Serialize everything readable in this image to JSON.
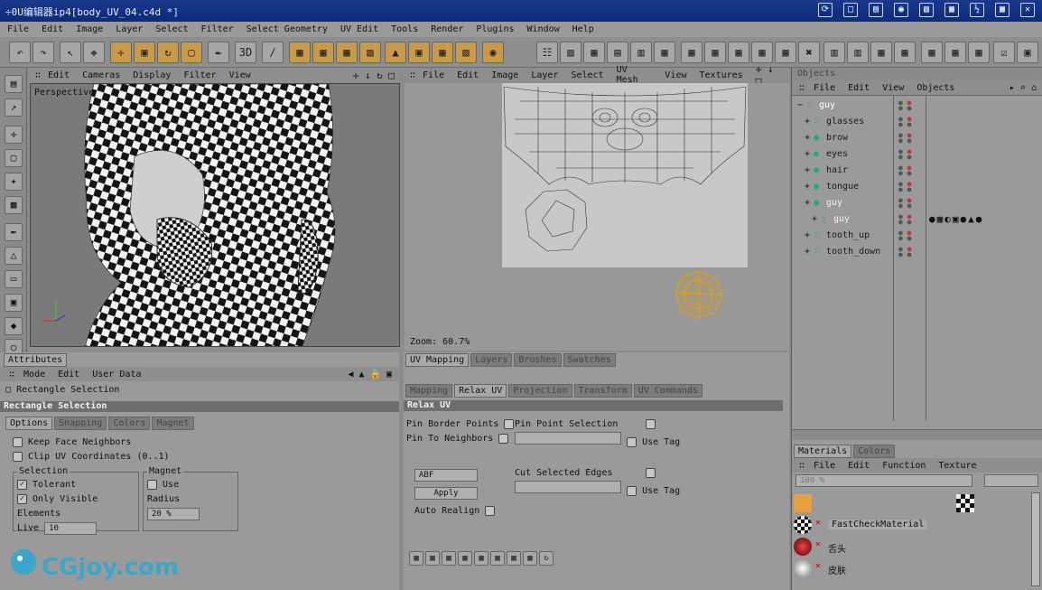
{
  "title": "÷0U编辑器ip4[body_UV_04.c4d *]",
  "menu": [
    "File",
    "Edit",
    "Image",
    "Layer",
    "Select",
    "Filter",
    "Select Geometry",
    "UV Edit",
    "Tools",
    "Render",
    "Plugins",
    "Window",
    "Help"
  ],
  "viewport": {
    "menu": [
      "Edit",
      "Cameras",
      "Display",
      "Filter",
      "View"
    ],
    "label": "Perspective"
  },
  "uv_editor": {
    "menu": [
      "File",
      "Edit",
      "Image",
      "Layer",
      "Select",
      "UV Mesh",
      "View",
      "Textures"
    ],
    "zoom": "Zoom: 60.7%"
  },
  "objects": {
    "title": "Objects",
    "menu": [
      "File",
      "Edit",
      "View",
      "Objects"
    ],
    "items": [
      {
        "label": "guy",
        "indent": 0,
        "expanded": true,
        "color": "#ffffff",
        "icon": "null-icon"
      },
      {
        "label": "glasses",
        "indent": 1,
        "color": "#1a1a1a",
        "icon": "null-icon"
      },
      {
        "label": "brow",
        "indent": 1,
        "color": "#1a1a1a",
        "icon": "polygon-icon"
      },
      {
        "label": "eyes",
        "indent": 1,
        "color": "#1a1a1a",
        "icon": "polygon-icon"
      },
      {
        "label": "hair",
        "indent": 1,
        "color": "#1a1a1a",
        "icon": "polygon-icon"
      },
      {
        "label": "tongue",
        "indent": 1,
        "color": "#1a1a1a",
        "icon": "polygon-icon"
      },
      {
        "label": "guy",
        "indent": 1,
        "color": "#f0f0f0",
        "icon": "polygon-icon"
      },
      {
        "label": "guy",
        "indent": 2,
        "color": "#f0f0f0",
        "icon": "cone-icon"
      },
      {
        "label": "tooth_up",
        "indent": 1,
        "color": "#1a1a1a",
        "icon": "null-icon"
      },
      {
        "label": "tooth_down",
        "indent": 1,
        "color": "#1a1a1a",
        "icon": "null-icon"
      }
    ]
  },
  "attributes": {
    "tab": "Attributes",
    "menu": [
      "Mode",
      "Edit",
      "User Data"
    ],
    "tool_name": "Rectangle Selection",
    "section": "Rectangle Selection",
    "subtabs": [
      "Options",
      "Snapping",
      "Colors",
      "Magnet"
    ],
    "keep_face_neighbors": "Keep Face Neighbors",
    "clip_uv": "Clip UV Coordinates (0..1)",
    "selection_group": "Selection",
    "tolerant": "Tolerant",
    "only_visible": "Only Visible Elements",
    "live_label": "Live",
    "live_value": "10",
    "magnet_group": "Magnet",
    "use_label": "Use",
    "radius_label": "Radius",
    "radius_value": "20 %"
  },
  "uv_mapping": {
    "tabs": [
      "UV Mapping",
      "Layers",
      "Brushes",
      "Swatches"
    ],
    "subtabs": [
      "Mapping",
      "Relax UV",
      "Projection",
      "Transform",
      "UV Commands"
    ],
    "section": "Relax UV",
    "pin_border": "Pin Border Points",
    "pin_neighbors": "Pin To Neighbors",
    "pin_point_sel": "Pin Point Selection",
    "use_tag": "Use Tag",
    "cut_edges": "Cut Selected Edges",
    "use_tag2": "Use Tag",
    "method": "ABF",
    "apply": "Apply",
    "auto_realign": "Auto Realign"
  },
  "materials": {
    "tabs": [
      "Materials",
      "Colors"
    ],
    "menu": [
      "File",
      "Edit",
      "Function",
      "Texture"
    ],
    "size": "100 %",
    "items": [
      "FastCheckMaterial",
      "舌头",
      "皮肤"
    ]
  },
  "watermark": {
    "brand": "CGjoy.com"
  }
}
